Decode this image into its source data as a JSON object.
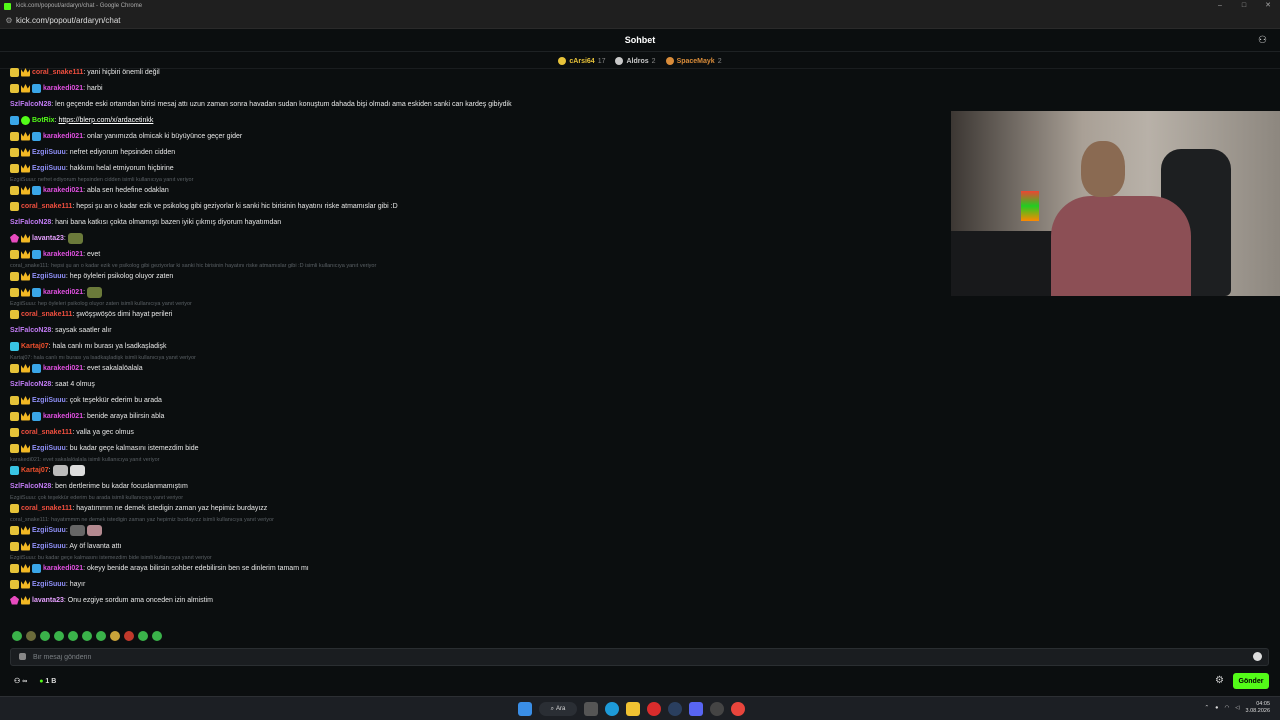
{
  "browser": {
    "window_title": "kick.com/popout/ardaryn/chat - Google Chrome",
    "url": "kick.com/popout/ardaryn/chat"
  },
  "header": {
    "title": "Sohbet"
  },
  "leaderboard": [
    {
      "name": "cArsi64",
      "count": "17",
      "color": "#e8c33a"
    },
    {
      "name": "Aldros",
      "count": "2",
      "color": "#c9c9c9"
    },
    {
      "name": "SpaceMayk",
      "count": "2",
      "color": "#d98c3a"
    }
  ],
  "messages": [
    {
      "kind": "msg",
      "badges": [
        "sub",
        "crown"
      ],
      "user": "coral_snake111",
      "ucls": "u-coral",
      "text": ": yani hiçbiri önemli değil"
    },
    {
      "kind": "msg",
      "badges": [
        "sub",
        "crown",
        "blue"
      ],
      "user": "karakedi021",
      "ucls": "u-kara",
      "text": ": harbi"
    },
    {
      "kind": "msg",
      "badges": [],
      "user": "SzlFalcoN28",
      "ucls": "u-szf",
      "text": ": len geçende eski ortamdan birisi mesaj attı uzun zaman sonra havadan sudan konuştum dahada bişi olmadı ama eskiden sanki can kardeş gibiydik"
    },
    {
      "kind": "msg",
      "badges": [
        "blue",
        "green"
      ],
      "user": "BotRix",
      "ucls": "u-bot",
      "text": ": ",
      "link": "https://blerp.com/x/ardacetinkk"
    },
    {
      "kind": "msg",
      "badges": [
        "sub",
        "crown",
        "blue"
      ],
      "user": "karakedi021",
      "ucls": "u-kara",
      "text": ": onlar yanımızda olmicak ki büyüyünce geçer gider"
    },
    {
      "kind": "msg",
      "badges": [
        "sub",
        "crown"
      ],
      "user": "EzgiiSuuu",
      "ucls": "u-ezg",
      "text": ": nefret ediyorum hepsinden cidden"
    },
    {
      "kind": "msg",
      "badges": [
        "sub",
        "crown"
      ],
      "user": "EzgiiSuuu",
      "ucls": "u-ezg",
      "text": ": hakkımı helal etmiyorum hiçbirine"
    },
    {
      "kind": "reply",
      "text": "EzgiiSuuu: nefret ediyorum hepsinden cidden isimli kullanıcıya yanıt veriyor"
    },
    {
      "kind": "msg",
      "badges": [
        "sub",
        "crown",
        "blue"
      ],
      "user": "karakedi021",
      "ucls": "u-kara",
      "text": ": abla sen hedefine odaklan"
    },
    {
      "kind": "msg",
      "badges": [
        "sub"
      ],
      "user": "coral_snake111",
      "ucls": "u-coral",
      "text": ": hepsi şu an o kadar ezik ve psikolog gibi geziyorlar ki sanki hic birisinin hayatını riske atmamıslar gibi :D"
    },
    {
      "kind": "msg",
      "badges": [],
      "user": "SzlFalcoN28",
      "ucls": "u-szf",
      "text": ": hani bana katkısı çokta olmamıştı bazen iyiki çıkmış diyorum hayatımdan"
    },
    {
      "kind": "msg",
      "badges": [
        "pink",
        "crown"
      ],
      "user": "lavanta23",
      "ucls": "u-lav",
      "text": ":",
      "emote": "#6b7a3a"
    },
    {
      "kind": "msg",
      "badges": [
        "sub",
        "crown",
        "blue"
      ],
      "user": "karakedi021",
      "ucls": "u-kara",
      "text": ": evet"
    },
    {
      "kind": "reply",
      "text": "coral_snake111: hepsi şu an o kadar ezik ve psikolog gibi geziyorlar ki sanki hic birisinin hayatını riske atmamıslar gibi :D isimli kullanıcıya yanıt veriyor"
    },
    {
      "kind": "msg",
      "badges": [
        "sub",
        "crown"
      ],
      "user": "EzgiiSuuu",
      "ucls": "u-ezg",
      "text": ": hep öyleleri psikolog oluyor zaten"
    },
    {
      "kind": "msg",
      "badges": [
        "sub",
        "crown",
        "blue"
      ],
      "user": "karakedi021",
      "ucls": "u-kara",
      "text": ":",
      "emote": "#6b7a3a"
    },
    {
      "kind": "reply",
      "text": "EzgiiSuuu: hep öyleleri psikolog oluyor zaten isimli kullanıcıya yanıt veriyor"
    },
    {
      "kind": "msg",
      "badges": [
        "sub"
      ],
      "user": "coral_snake111",
      "ucls": "u-coral",
      "text": ": şwöşşwöşös dimi hayat perileri"
    },
    {
      "kind": "msg",
      "badges": [],
      "user": "SzlFalcoN28",
      "ucls": "u-szf",
      "text": ": saysak saatler alır"
    },
    {
      "kind": "msg",
      "badges": [
        "teal"
      ],
      "user": "Kartaj07",
      "ucls": "u-kart",
      "text": ": hala canlı mı burası ya lsadkaşladişk"
    },
    {
      "kind": "reply",
      "text": "Kartaj07: hala canlı mı burası ya lsadkaşladişk isimli kullanıcıya yanıt veriyor"
    },
    {
      "kind": "msg",
      "badges": [
        "sub",
        "crown",
        "blue"
      ],
      "user": "karakedi021",
      "ucls": "u-kara",
      "text": ": evet sakalalöalala"
    },
    {
      "kind": "msg",
      "badges": [],
      "user": "SzlFalcoN28",
      "ucls": "u-szf",
      "text": ": saat 4 olmuş"
    },
    {
      "kind": "msg",
      "badges": [
        "sub",
        "crown"
      ],
      "user": "EzgiiSuuu",
      "ucls": "u-ezg",
      "text": ": çok teşekkür ederim bu arada"
    },
    {
      "kind": "msg",
      "badges": [
        "sub",
        "crown",
        "blue"
      ],
      "user": "karakedi021",
      "ucls": "u-kara",
      "text": ": benide araya bilirsin abla"
    },
    {
      "kind": "msg",
      "badges": [
        "sub"
      ],
      "user": "coral_snake111",
      "ucls": "u-coral",
      "text": ": valla ya gec olmus"
    },
    {
      "kind": "msg",
      "badges": [
        "sub",
        "crown"
      ],
      "user": "EzgiiSuuu",
      "ucls": "u-ezg",
      "text": ": bu kadar geçe kalmasını istemezdim bide"
    },
    {
      "kind": "reply",
      "text": "karakedi021: evet sakalalöalala isimli kullanıcıya yanıt veriyor"
    },
    {
      "kind": "msg",
      "badges": [
        "teal"
      ],
      "user": "Kartaj07",
      "ucls": "u-kart",
      "text": ":",
      "emote": "#bbbbbb",
      "emote2": "#dddddd"
    },
    {
      "kind": "msg",
      "badges": [],
      "user": "SzlFalcoN28",
      "ucls": "u-szf",
      "text": ": ben dertlerime bu kadar focuslanmamıştım"
    },
    {
      "kind": "reply",
      "text": "EzgiiSuuu: çok teşekkür ederim bu arada isimli kullanıcıya yanıt veriyor"
    },
    {
      "kind": "msg",
      "badges": [
        "sub"
      ],
      "user": "coral_snake111",
      "ucls": "u-coral",
      "text": ": hayatımmm ne demek istedigin zaman yaz hepimiz burdayızz"
    },
    {
      "kind": "reply",
      "text": "coral_snake111: hayatımmm ne demek istedigin zaman yaz hepimiz burdayızz isimli kullanıcıya yanıt veriyor"
    },
    {
      "kind": "msg",
      "badges": [
        "sub",
        "crown"
      ],
      "user": "EzgiiSuuu",
      "ucls": "u-ezg",
      "text": ":",
      "emote": "#666666",
      "emote2": "#b48a90"
    },
    {
      "kind": "msg",
      "badges": [
        "sub",
        "crown"
      ],
      "user": "EzgiiSuuu",
      "ucls": "u-ezg",
      "text": ": Ay öf lavanta attı"
    },
    {
      "kind": "reply",
      "text": "EzgiiSuuu: bu kadar geçe kalmasını istemezdim bide isimli kullanıcıya yanıt veriyor"
    },
    {
      "kind": "msg",
      "badges": [
        "sub",
        "crown",
        "blue"
      ],
      "user": "karakedi021",
      "ucls": "u-kara",
      "text": ": okeyy benide araya bilirsin sohber edebilirsin ben se dinlerim tamam mı"
    },
    {
      "kind": "msg",
      "badges": [
        "sub",
        "crown"
      ],
      "user": "EzgiiSuuu",
      "ucls": "u-ezg",
      "text": ": hayır"
    },
    {
      "kind": "msg",
      "badges": [
        "pink",
        "crown"
      ],
      "user": "lavanta23",
      "ucls": "u-lav",
      "text": ": Onu ezgiye sordum ama onceden izin almistim"
    }
  ],
  "input": {
    "placeholder": "Bir mesaj gönderin"
  },
  "bottom": {
    "connections": "∞",
    "points": "1 B",
    "send_label": "Gönder"
  },
  "taskbar": {
    "search_label": "Ara",
    "time": "04:05",
    "date": "3.08.2026"
  },
  "colors": {
    "accent": "#53fc18",
    "background": "#0b0e0f"
  }
}
